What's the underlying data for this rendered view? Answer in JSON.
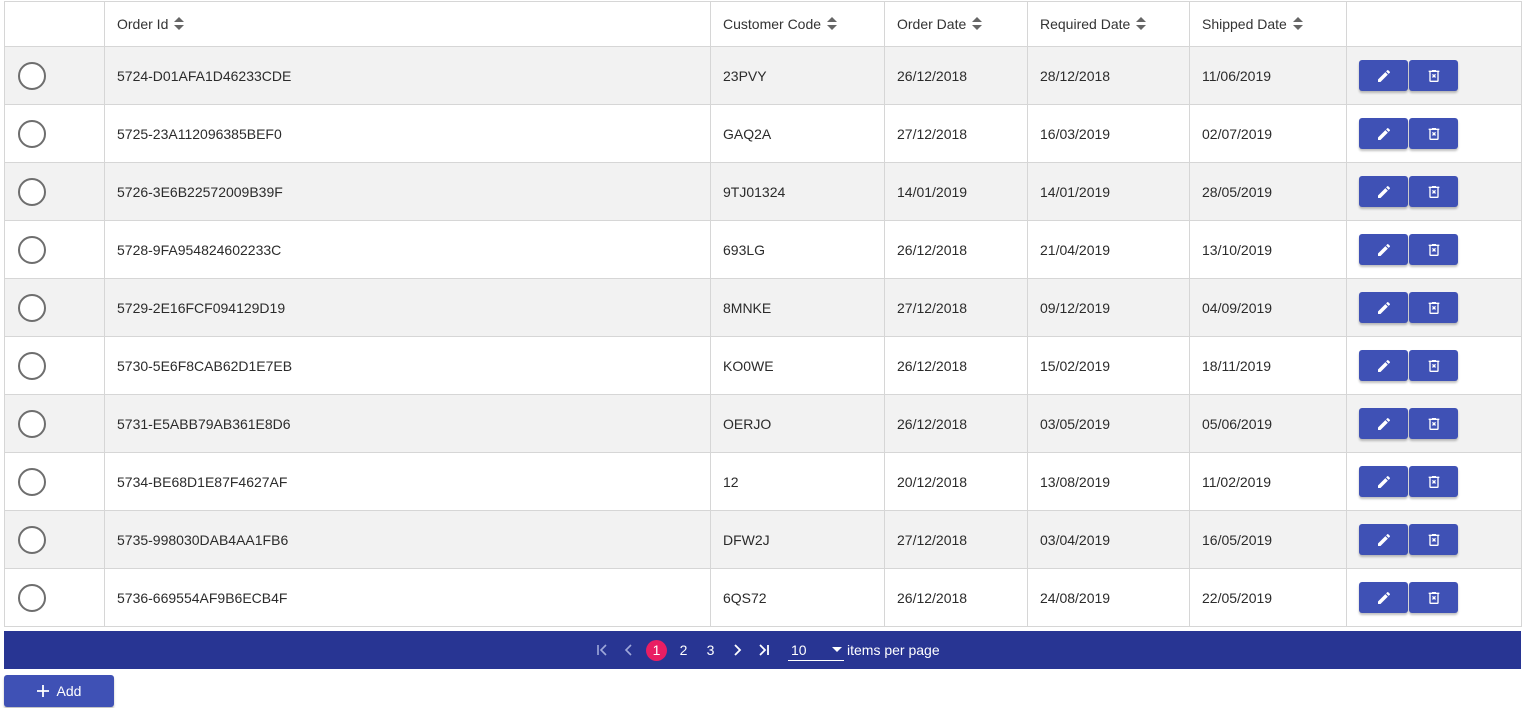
{
  "grid": {
    "columns": [
      {
        "key": "select",
        "label": ""
      },
      {
        "key": "order_id",
        "label": "Order Id"
      },
      {
        "key": "customer_code",
        "label": "Customer Code"
      },
      {
        "key": "order_date",
        "label": "Order Date"
      },
      {
        "key": "required_date",
        "label": "Required Date"
      },
      {
        "key": "shipped_date",
        "label": "Shipped Date"
      },
      {
        "key": "actions",
        "label": ""
      }
    ],
    "rows": [
      {
        "order_id": "5724-D01AFA1D46233CDE",
        "customer_code": "23PVY",
        "order_date": "26/12/2018",
        "required_date": "28/12/2018",
        "shipped_date": "11/06/2019"
      },
      {
        "order_id": "5725-23A112096385BEF0",
        "customer_code": "GAQ2A",
        "order_date": "27/12/2018",
        "required_date": "16/03/2019",
        "shipped_date": "02/07/2019"
      },
      {
        "order_id": "5726-3E6B22572009B39F",
        "customer_code": "9TJ01324",
        "order_date": "14/01/2019",
        "required_date": "14/01/2019",
        "shipped_date": "28/05/2019"
      },
      {
        "order_id": "5728-9FA954824602233C",
        "customer_code": "693LG",
        "order_date": "26/12/2018",
        "required_date": "21/04/2019",
        "shipped_date": "13/10/2019"
      },
      {
        "order_id": "5729-2E16FCF094129D19",
        "customer_code": "8MNKE",
        "order_date": "27/12/2018",
        "required_date": "09/12/2019",
        "shipped_date": "04/09/2019"
      },
      {
        "order_id": "5730-5E6F8CAB62D1E7EB",
        "customer_code": "KO0WE",
        "order_date": "26/12/2018",
        "required_date": "15/02/2019",
        "shipped_date": "18/11/2019"
      },
      {
        "order_id": "5731-E5ABB79AB361E8D6",
        "customer_code": "OERJO",
        "order_date": "26/12/2018",
        "required_date": "03/05/2019",
        "shipped_date": "05/06/2019"
      },
      {
        "order_id": "5734-BE68D1E87F4627AF",
        "customer_code": "12",
        "order_date": "20/12/2018",
        "required_date": "13/08/2019",
        "shipped_date": "11/02/2019"
      },
      {
        "order_id": "5735-998030DAB4AA1FB6",
        "customer_code": "DFW2J",
        "order_date": "27/12/2018",
        "required_date": "03/04/2019",
        "shipped_date": "16/05/2019"
      },
      {
        "order_id": "5736-669554AF9B6ECB4F",
        "customer_code": "6QS72",
        "order_date": "26/12/2018",
        "required_date": "24/08/2019",
        "shipped_date": "22/05/2019"
      }
    ],
    "row_actions": {
      "edit_icon": "pencil-icon",
      "delete_icon": "trash-icon"
    }
  },
  "pager": {
    "pages": [
      "1",
      "2",
      "3"
    ],
    "current_page": "1",
    "page_size": "10",
    "items_per_page_label": "items per page",
    "icons": {
      "first": "first-page-icon",
      "prev": "chevron-left-icon",
      "next": "chevron-right-icon",
      "last": "last-page-icon"
    }
  },
  "toolbar": {
    "add_label": "Add",
    "add_icon": "plus-icon"
  },
  "colors": {
    "primary": "#3f51b5",
    "pager_bg": "#283593",
    "active_page": "#e91e63",
    "row_alt": "#f2f2f2"
  }
}
